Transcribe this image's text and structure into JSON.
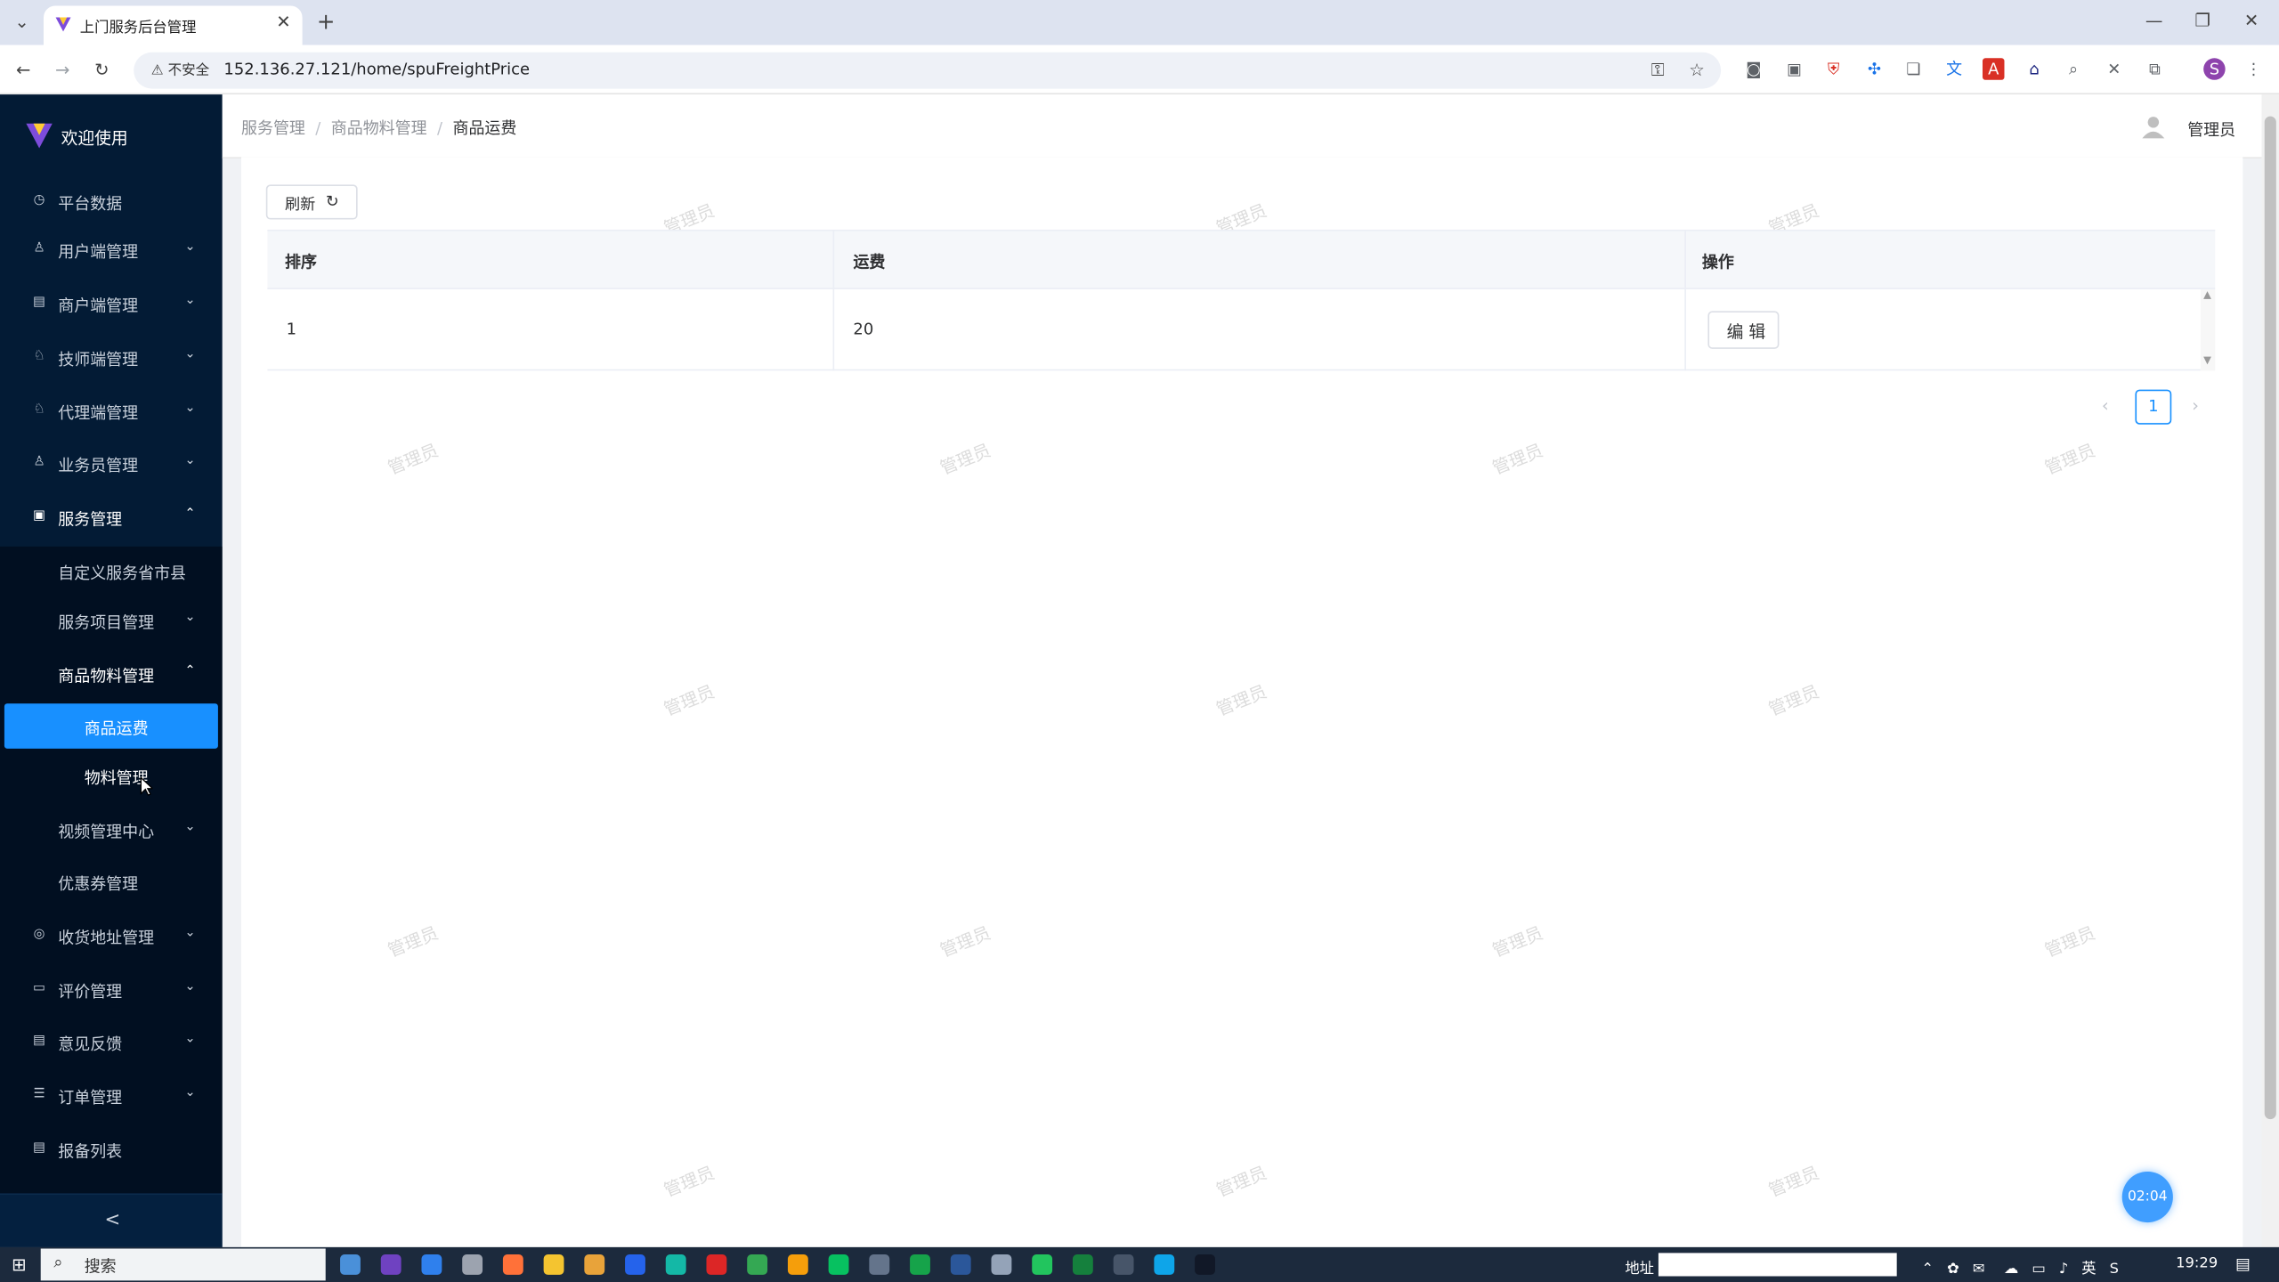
{
  "browser": {
    "tab_title": "上门服务后台管理",
    "security_label": "不安全",
    "url": "152.136.27.121/home/spuFreightPrice",
    "profile_initial": "S"
  },
  "sidebar": {
    "brand": "欢迎使用",
    "menu": [
      {
        "label": "平台数据",
        "icon": "dashboard-icon"
      },
      {
        "label": "用户端管理",
        "icon": "user-icon"
      },
      {
        "label": "商户端管理",
        "icon": "shop-icon"
      },
      {
        "label": "技师端管理",
        "icon": "technician-icon"
      },
      {
        "label": "代理端管理",
        "icon": "agent-icon"
      },
      {
        "label": "业务员管理",
        "icon": "user-icon"
      },
      {
        "label": "服务管理",
        "icon": "service-icon"
      }
    ],
    "submenu": [
      {
        "label": "自定义服务省市县"
      },
      {
        "label": "服务项目管理"
      },
      {
        "label": "商品物料管理"
      },
      {
        "label": "商品运费"
      },
      {
        "label": "物料管理"
      },
      {
        "label": "视频管理中心"
      },
      {
        "label": "优惠券管理"
      }
    ],
    "menu_lower": [
      {
        "label": "收货地址管理",
        "icon": "location-icon"
      },
      {
        "label": "评价管理",
        "icon": "review-icon"
      },
      {
        "label": "意见反馈",
        "icon": "feedback-icon"
      },
      {
        "label": "订单管理",
        "icon": "order-icon"
      },
      {
        "label": "报备列表",
        "icon": "report-icon"
      }
    ],
    "collapse_glyph": "<"
  },
  "header": {
    "breadcrumb": [
      "服务管理",
      "商品物料管理",
      "商品运费"
    ],
    "user_name": "管理员"
  },
  "toolbar": {
    "refresh_label": "刷新"
  },
  "table": {
    "columns": [
      "排序",
      "运费",
      "操作"
    ],
    "rows": [
      {
        "sort": "1",
        "freight": "20",
        "action": "编 辑"
      }
    ]
  },
  "pagination": {
    "current": "1"
  },
  "watermark": "管理员",
  "timer": "02:04",
  "taskbar": {
    "search_label": "搜索",
    "address_label": "地址",
    "ime": "英",
    "time": "19:29"
  },
  "colors": {
    "sidebar_bg": "#031b35",
    "active_item": "#1890ff",
    "accent": "#409eff"
  }
}
